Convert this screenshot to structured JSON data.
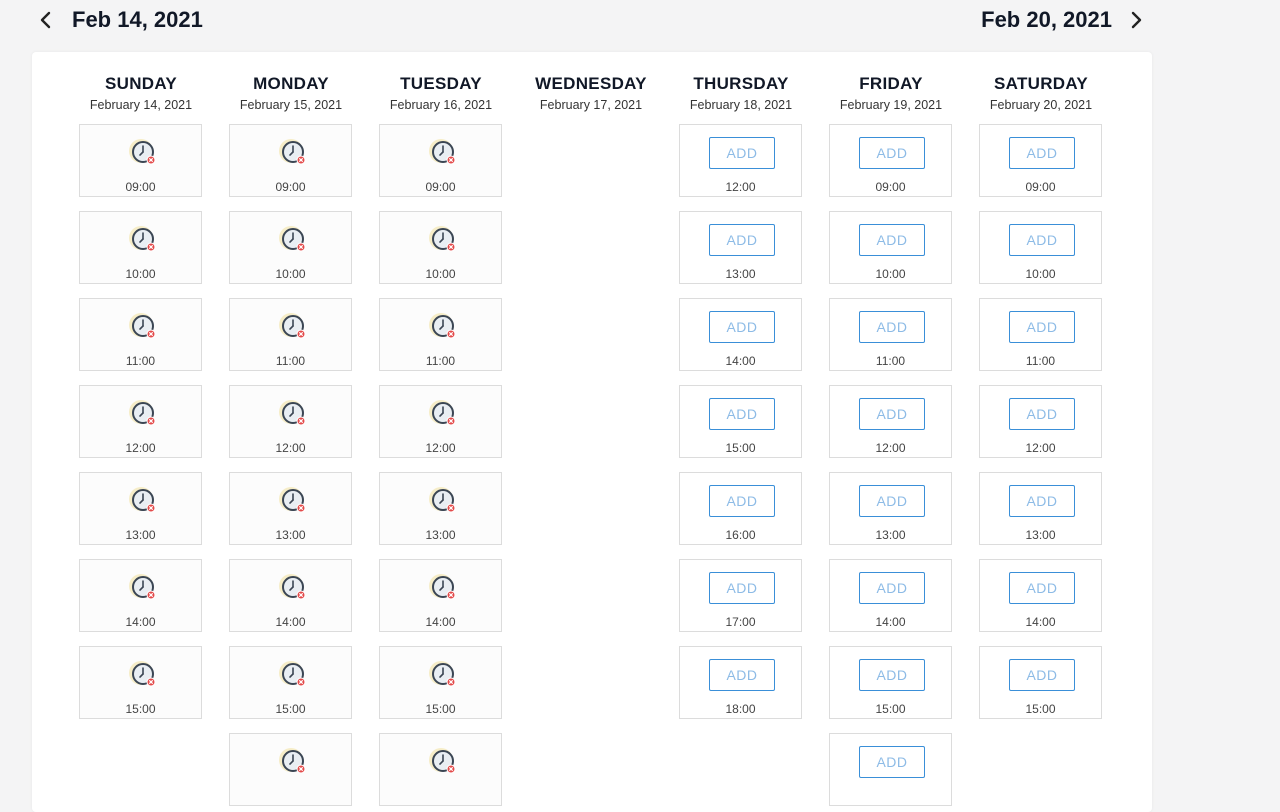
{
  "nav": {
    "prev_icon": "chevron-left-icon",
    "next_icon": "chevron-right-icon",
    "start_label": "Feb 14, 2021",
    "end_label": "Feb 20, 2021"
  },
  "colors": {
    "accent": "#3a8fd8",
    "add_text": "#8dbbe6",
    "clock_bg": "#f6edc8"
  },
  "days": [
    {
      "name": "SUNDAY",
      "date": "February 14, 2021",
      "slots": [
        {
          "time": "09:00",
          "state": "unavailable"
        },
        {
          "time": "10:00",
          "state": "unavailable"
        },
        {
          "time": "11:00",
          "state": "unavailable"
        },
        {
          "time": "12:00",
          "state": "unavailable"
        },
        {
          "time": "13:00",
          "state": "unavailable"
        },
        {
          "time": "14:00",
          "state": "unavailable"
        },
        {
          "time": "15:00",
          "state": "unavailable"
        }
      ]
    },
    {
      "name": "MONDAY",
      "date": "February 15, 2021",
      "slots": [
        {
          "time": "09:00",
          "state": "unavailable"
        },
        {
          "time": "10:00",
          "state": "unavailable"
        },
        {
          "time": "11:00",
          "state": "unavailable"
        },
        {
          "time": "12:00",
          "state": "unavailable"
        },
        {
          "time": "13:00",
          "state": "unavailable"
        },
        {
          "time": "14:00",
          "state": "unavailable"
        },
        {
          "time": "15:00",
          "state": "unavailable"
        },
        {
          "time": "",
          "state": "unavailable"
        }
      ]
    },
    {
      "name": "TUESDAY",
      "date": "February 16, 2021",
      "slots": [
        {
          "time": "09:00",
          "state": "unavailable"
        },
        {
          "time": "10:00",
          "state": "unavailable"
        },
        {
          "time": "11:00",
          "state": "unavailable"
        },
        {
          "time": "12:00",
          "state": "unavailable"
        },
        {
          "time": "13:00",
          "state": "unavailable"
        },
        {
          "time": "14:00",
          "state": "unavailable"
        },
        {
          "time": "15:00",
          "state": "unavailable"
        },
        {
          "time": "",
          "state": "unavailable"
        }
      ]
    },
    {
      "name": "WEDNESDAY",
      "date": "February 17, 2021",
      "slots": []
    },
    {
      "name": "THURSDAY",
      "date": "February 18, 2021",
      "slots": [
        {
          "time": "12:00",
          "state": "available",
          "button": "ADD"
        },
        {
          "time": "13:00",
          "state": "available",
          "button": "ADD"
        },
        {
          "time": "14:00",
          "state": "available",
          "button": "ADD"
        },
        {
          "time": "15:00",
          "state": "available",
          "button": "ADD"
        },
        {
          "time": "16:00",
          "state": "available",
          "button": "ADD"
        },
        {
          "time": "17:00",
          "state": "available",
          "button": "ADD"
        },
        {
          "time": "18:00",
          "state": "available",
          "button": "ADD"
        }
      ]
    },
    {
      "name": "FRIDAY",
      "date": "February 19, 2021",
      "slots": [
        {
          "time": "09:00",
          "state": "available",
          "button": "ADD"
        },
        {
          "time": "10:00",
          "state": "available",
          "button": "ADD"
        },
        {
          "time": "11:00",
          "state": "available",
          "button": "ADD"
        },
        {
          "time": "12:00",
          "state": "available",
          "button": "ADD"
        },
        {
          "time": "13:00",
          "state": "available",
          "button": "ADD"
        },
        {
          "time": "14:00",
          "state": "available",
          "button": "ADD"
        },
        {
          "time": "15:00",
          "state": "available",
          "button": "ADD"
        },
        {
          "time": "",
          "state": "available",
          "button": "ADD"
        }
      ]
    },
    {
      "name": "SATURDAY",
      "date": "February 20, 2021",
      "slots": [
        {
          "time": "09:00",
          "state": "available",
          "button": "ADD"
        },
        {
          "time": "10:00",
          "state": "available",
          "button": "ADD"
        },
        {
          "time": "11:00",
          "state": "available",
          "button": "ADD"
        },
        {
          "time": "12:00",
          "state": "available",
          "button": "ADD"
        },
        {
          "time": "13:00",
          "state": "available",
          "button": "ADD"
        },
        {
          "time": "14:00",
          "state": "available",
          "button": "ADD"
        },
        {
          "time": "15:00",
          "state": "available",
          "button": "ADD"
        }
      ]
    }
  ]
}
